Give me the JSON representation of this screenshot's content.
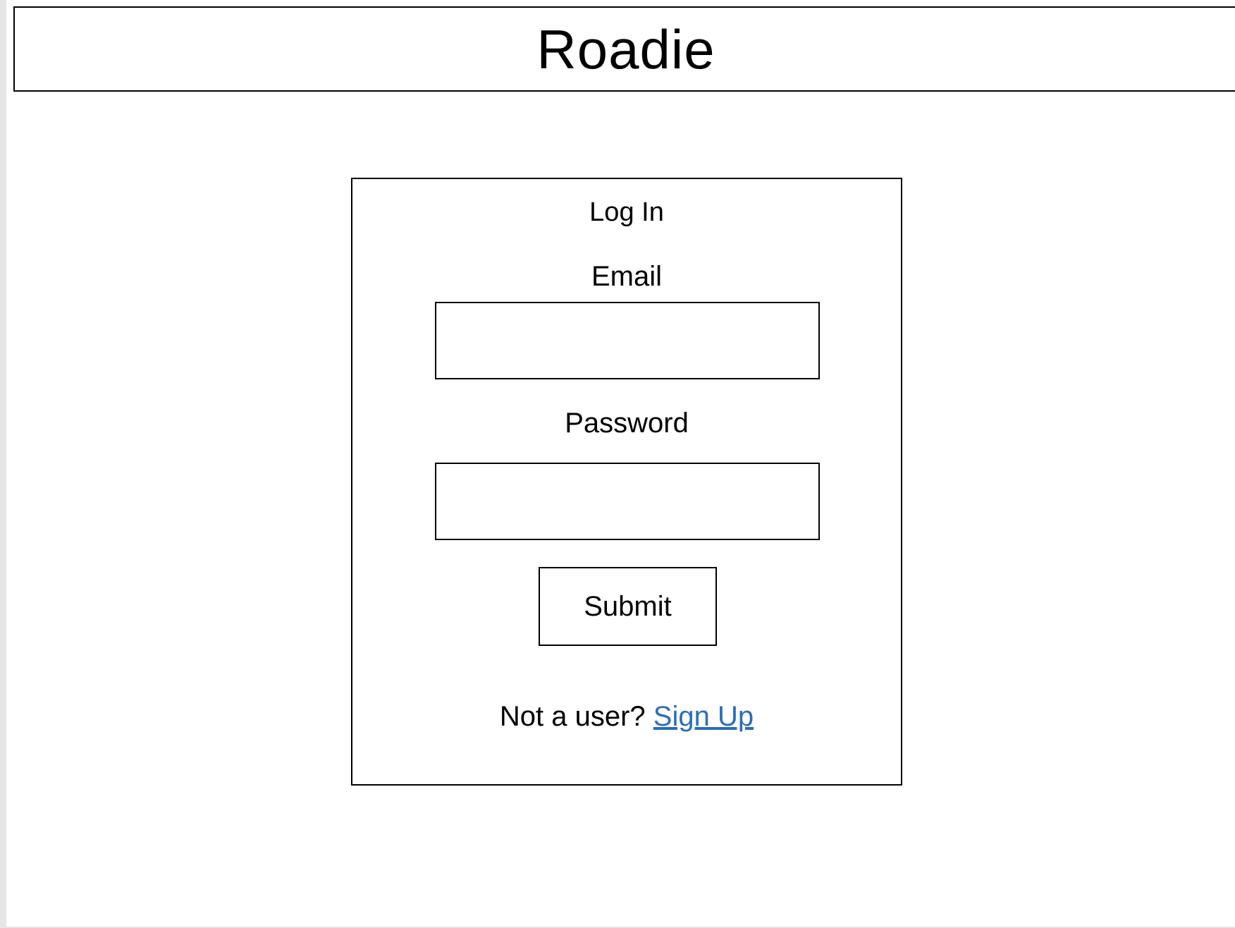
{
  "header": {
    "app_title": "Roadie"
  },
  "login": {
    "title": "Log In",
    "email_label": "Email",
    "email_value": "",
    "password_label": "Password",
    "password_value": "",
    "submit_label": "Submit",
    "signup_prompt": "Not a user? ",
    "signup_link": "Sign Up"
  },
  "colors": {
    "link": "#2a6ebb",
    "border": "#000000",
    "background": "#ffffff"
  }
}
